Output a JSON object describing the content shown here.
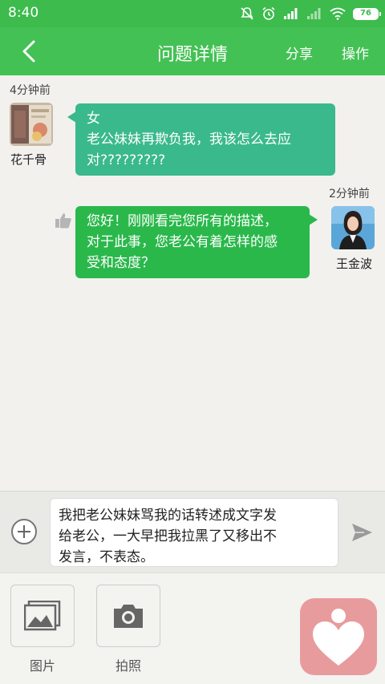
{
  "status_bar": {
    "time": "8:40",
    "battery": "76",
    "icons": [
      "mute-bell-icon",
      "alarm-icon",
      "signal-icon",
      "signal-weak-icon",
      "wifi-icon",
      "battery-icon"
    ]
  },
  "nav": {
    "back_icon": "chevron-left-icon",
    "title": "问题详情",
    "share": "分享",
    "operate": "操作"
  },
  "messages": [
    {
      "side": "left",
      "time": "4分钟前",
      "user": "花千骨",
      "lines": [
        "女",
        "老公妹妹再欺负我，我该怎么去应",
        "对?????????"
      ]
    },
    {
      "side": "right",
      "time": "2分钟前",
      "user": "王金波",
      "lines": [
        "您好！刚刚看完您所有的描述，",
        "对于此事，您老公有着怎样的感",
        "受和态度？"
      ],
      "icon": "thumbs-up-icon"
    }
  ],
  "composer": {
    "plus_icon": "plus-circle-icon",
    "lines": [
      "我把老公妹妹骂我的话转述成文字发",
      "给老公，一大早把我拉黑了又移出不",
      "发言，不表态。"
    ],
    "send_icon": "send-icon"
  },
  "tools": [
    {
      "label": "图片",
      "icon": "image-icon"
    },
    {
      "label": "拍照",
      "icon": "camera-icon"
    }
  ],
  "fab_icon": "heart-person-icon",
  "colors": {
    "header_green": "#44c154",
    "left_bubble": "#3ab98d",
    "right_bubble": "#2ab84b",
    "fab_pink": "#e89b9d"
  }
}
